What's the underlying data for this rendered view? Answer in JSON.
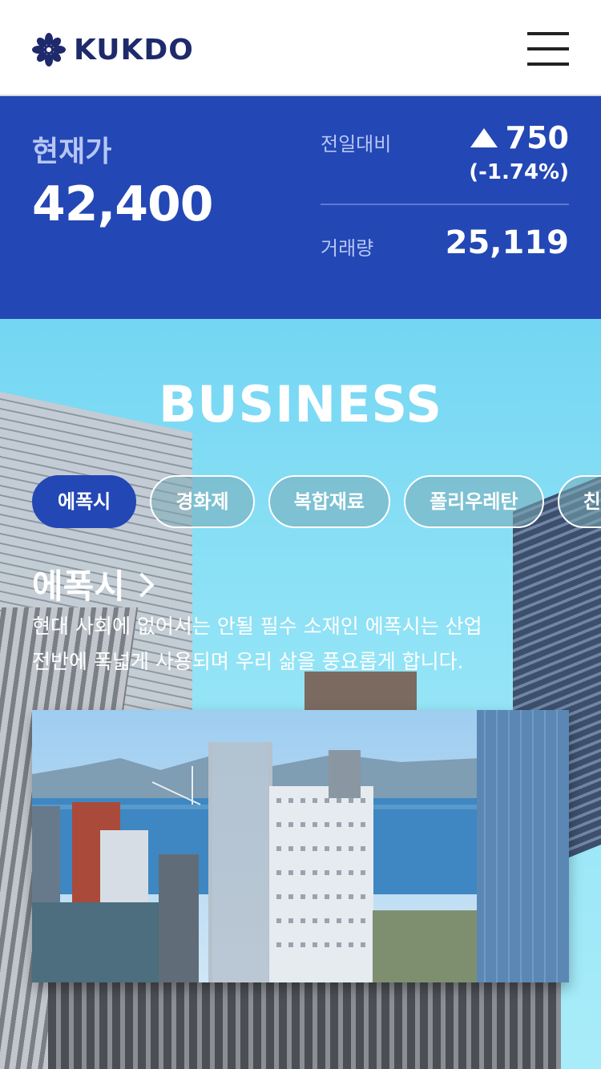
{
  "header": {
    "logo_text": "KUKDO",
    "logo_icon": "kukdo-flower-logo-icon",
    "menu_icon": "hamburger-menu-icon"
  },
  "stock": {
    "current_label": "현재가",
    "current_price": "42,400",
    "change_label": "전일대비",
    "change_value": "750",
    "change_direction_icon": "triangle-up-icon",
    "change_percent": "(-1.74%)",
    "volume_label": "거래량",
    "volume_value": "25,119"
  },
  "business": {
    "title": "BUSINESS",
    "tabs": [
      {
        "label": "에폭시",
        "active": true
      },
      {
        "label": "경화제",
        "active": false
      },
      {
        "label": "복합재료",
        "active": false
      },
      {
        "label": "폴리우레탄",
        "active": false
      },
      {
        "label": "친",
        "active": false
      }
    ],
    "category_title": "에폭시",
    "category_desc_line1": "현대 사회에 없어서는 안될 필수 소재인 에폭시는 산업",
    "category_desc_line2": "전반에 폭넓게 사용되며 우리 삶을 풍요롭게 합니다."
  },
  "colors": {
    "brand_navy": "#1e2a6b",
    "stock_bg": "#2347b5",
    "sky": "#8fe2f6"
  }
}
